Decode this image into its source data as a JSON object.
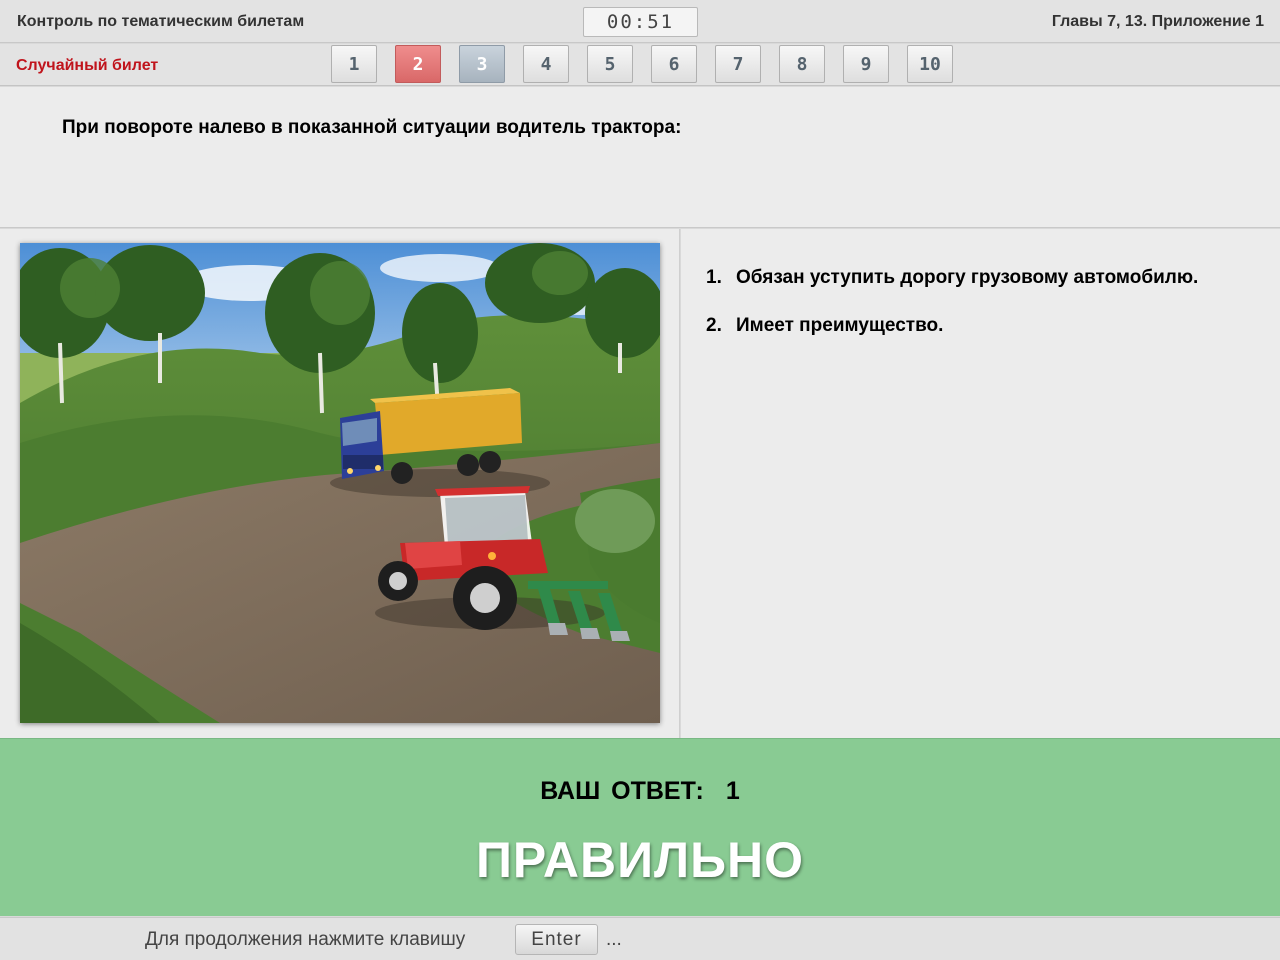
{
  "header": {
    "title": "Контроль по тематическим билетам",
    "timer": "00:51",
    "section": "Главы 7, 13. Приложение 1"
  },
  "nav": {
    "label": "Случайный билет",
    "tickets": [
      "1",
      "2",
      "3",
      "4",
      "5",
      "6",
      "7",
      "8",
      "9",
      "10"
    ]
  },
  "question": {
    "text": "При повороте налево в показанной ситуации водитель трактора:"
  },
  "answers": [
    {
      "num": "1.",
      "text": "Обязан уступить дорогу грузовому автомобилю."
    },
    {
      "num": "2.",
      "text": "Имеет преимущество."
    }
  ],
  "result": {
    "label": "ВАШ  ОТВЕТ:",
    "answer": "1",
    "verdict": "ПРАВИЛЬНО"
  },
  "footer": {
    "text": "Для продолжения нажмите клавишу",
    "key": "Enter",
    "ellipsis": "..."
  },
  "colors": {
    "random_label": "#c0141c",
    "result_bg": "#89cb93",
    "ticket_wrong": "#d96868",
    "ticket_current": "#a7b3be"
  }
}
